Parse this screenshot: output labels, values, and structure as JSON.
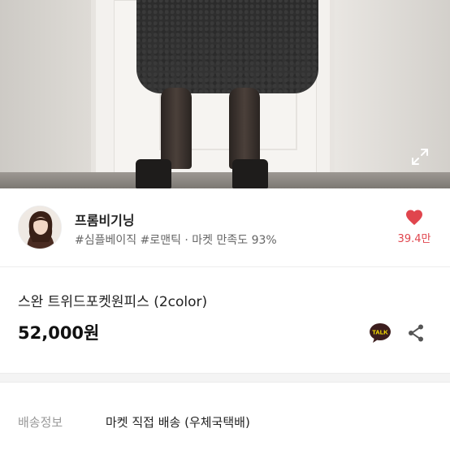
{
  "seller": {
    "name": "프롬비기닝",
    "tags": "#심플베이직 #로맨틱 · 마켓 만족도 93%",
    "likes": "39.4만"
  },
  "product": {
    "title": "스완 트위드포켓원피스 (2color)",
    "price": "52,000원"
  },
  "delivery": {
    "label": "배송정보",
    "value": "마켓 직접 배송 (우체국택배)"
  },
  "icons": {
    "expand": "expand-icon",
    "heart": "heart-icon",
    "talk": "kakaotalk-icon",
    "talk_text": "TALK",
    "share": "share-icon"
  },
  "colors": {
    "accent": "#e0454d",
    "talk_bg": "#3c1e1e",
    "talk_fg": "#fee500"
  }
}
